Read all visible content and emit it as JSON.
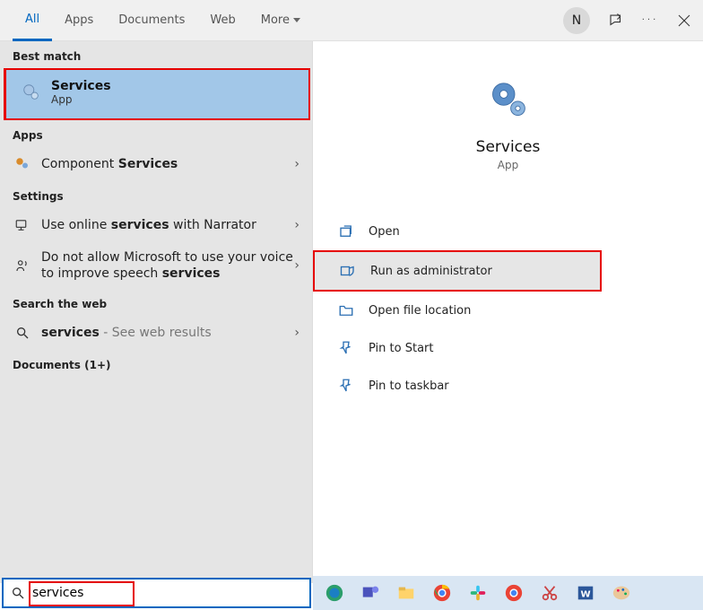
{
  "tabs": {
    "all": "All",
    "apps": "Apps",
    "documents": "Documents",
    "web": "Web",
    "more": "More"
  },
  "user": {
    "avatar_letter": "N"
  },
  "left": {
    "best_match_hdr": "Best match",
    "best": {
      "title": "Services",
      "sub": "App"
    },
    "apps_hdr": "Apps",
    "component_pre": "Component ",
    "component_bold": "Services",
    "settings_hdr": "Settings",
    "narrator_pre": "Use online ",
    "narrator_bold": "services",
    "narrator_post": " with Narrator",
    "speech_pre": "Do not allow Microsoft to use your voice to improve speech ",
    "speech_bold": "services",
    "web_hdr": "Search the web",
    "web_bold": "services",
    "web_post": " - See web results",
    "docs_hdr": "Documents (1+)"
  },
  "preview": {
    "title": "Services",
    "sub": "App"
  },
  "actions": {
    "open": "Open",
    "run_admin": "Run as administrator",
    "open_loc": "Open file location",
    "pin_start": "Pin to Start",
    "pin_taskbar": "Pin to taskbar"
  },
  "search": {
    "value": "services"
  }
}
